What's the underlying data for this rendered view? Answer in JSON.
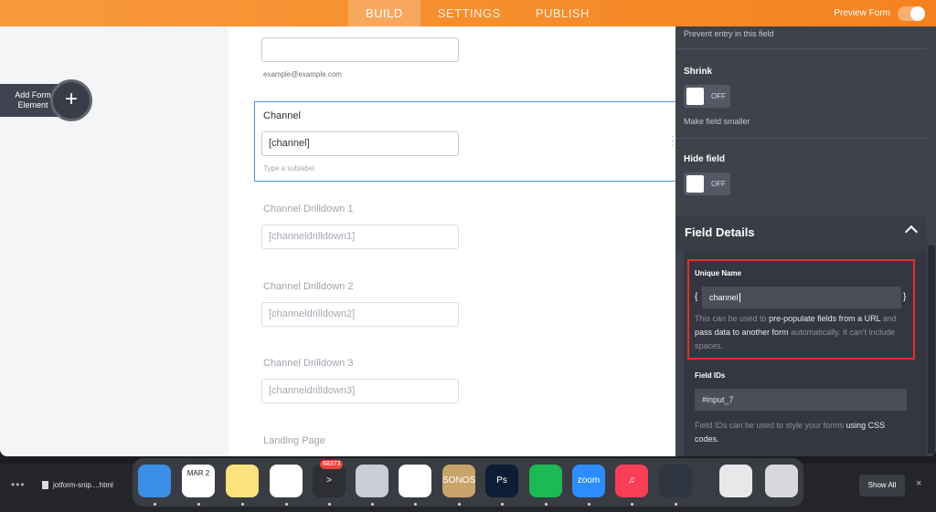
{
  "topbar": {
    "tabs": [
      {
        "label": "BUILD",
        "active": true
      },
      {
        "label": "SETTINGS",
        "active": false
      },
      {
        "label": "PUBLISH",
        "active": false
      }
    ],
    "preview_label": "Preview Form"
  },
  "left_panel": {
    "add_element_label": "Add Form Element",
    "add_icon": "+"
  },
  "canvas": {
    "email_hint": "example@example.com",
    "channel": {
      "label": "Channel",
      "value": "[channel]",
      "sublabel_placeholder": "Type a sublabel"
    },
    "drilldowns": [
      {
        "label": "Channel Drilldown 1",
        "value": "[channeldrilldown1]"
      },
      {
        "label": "Channel Drilldown 2",
        "value": "[channeldrilldown2]"
      },
      {
        "label": "Channel Drilldown 3",
        "value": "[channeldrilldown3]"
      }
    ],
    "landing_label": "Landing Page"
  },
  "right_panel": {
    "readonly_help": "Prevent entry in this field",
    "shrink": {
      "title": "Shrink",
      "toggle": "OFF",
      "help": "Make field smaller"
    },
    "hide": {
      "title": "Hide field",
      "toggle": "OFF"
    },
    "section_title": "Field Details",
    "unique_name": {
      "title": "Unique Name",
      "open_brace": "{",
      "close_brace": "}",
      "value": "channel",
      "help_1": "This can be used to ",
      "help_b1": "pre-populate fields from a URL",
      "help_2": " and ",
      "help_b2": "pass data to another form",
      "help_3": " automatically. It can't include spaces."
    },
    "field_ids": {
      "title": "Field IDs",
      "value": "#input_7",
      "help_1": "Field IDs can be used to style your forms ",
      "help_b1": "using CSS codes."
    }
  },
  "taskbar": {
    "file_name": "jotform-snip....html",
    "show_all": "Show All",
    "close": "×",
    "dock": [
      {
        "name": "finder",
        "label": "",
        "color": "#3a8ee6"
      },
      {
        "name": "calendar",
        "label": "MAR 2",
        "color": "#ffffff"
      },
      {
        "name": "notes",
        "label": "",
        "color": "#fbe27a"
      },
      {
        "name": "slack",
        "label": "",
        "color": "#ffffff"
      },
      {
        "name": "prompt-app",
        "label": ">",
        "color": "#2e2f34",
        "badge": "68373"
      },
      {
        "name": "launchpad",
        "label": "",
        "color": "#c9ced6"
      },
      {
        "name": "chrome",
        "label": "",
        "color": "#ffffff"
      },
      {
        "name": "sonos",
        "label": "SONOS",
        "color": "#c8a46a"
      },
      {
        "name": "photoshop",
        "label": "Ps",
        "color": "#0d1d35"
      },
      {
        "name": "spotify",
        "label": "",
        "color": "#1db954"
      },
      {
        "name": "zoom",
        "label": "zoom",
        "color": "#2d8cff"
      },
      {
        "name": "music",
        "label": "♫",
        "color": "#fa3e56"
      },
      {
        "name": "quicktime",
        "label": "",
        "color": "#2f3642"
      },
      {
        "name": "preview",
        "label": "",
        "color": "#e8e8ea"
      },
      {
        "name": "trash",
        "label": "",
        "color": "#d6d8dc"
      }
    ]
  }
}
